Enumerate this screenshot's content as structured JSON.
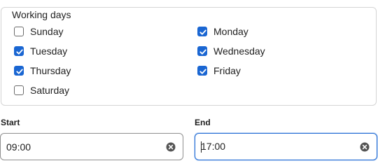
{
  "fieldset": {
    "legend": "Working days",
    "days": [
      {
        "label": "Sunday",
        "checked": false
      },
      {
        "label": "Monday",
        "checked": true
      },
      {
        "label": "Tuesday",
        "checked": true
      },
      {
        "label": "Wednesday",
        "checked": true
      },
      {
        "label": "Thursday",
        "checked": true
      },
      {
        "label": "Friday",
        "checked": true
      },
      {
        "label": "Saturday",
        "checked": false
      }
    ]
  },
  "start": {
    "label": "Start",
    "value": "09:00"
  },
  "end": {
    "label": "End",
    "value": "17:00"
  },
  "colors": {
    "accent": "#1a66d2",
    "border": "#d4d4d4"
  }
}
